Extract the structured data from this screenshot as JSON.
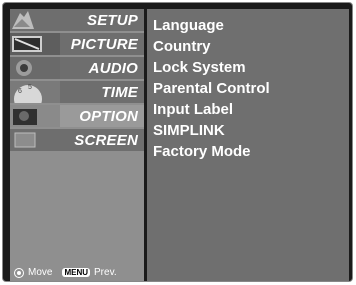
{
  "menu": {
    "items": [
      {
        "label": "SETUP"
      },
      {
        "label": "PICTURE"
      },
      {
        "label": "AUDIO"
      },
      {
        "label": "TIME"
      },
      {
        "label": "OPTION"
      },
      {
        "label": "SCREEN"
      }
    ],
    "selected": "OPTION"
  },
  "footer": {
    "move_label": "Move",
    "menu_badge": "MENU",
    "prev_label": "Prev."
  },
  "options": [
    "Language",
    "Country",
    "Lock System",
    "Parental Control",
    "Input Label",
    "SIMPLINK",
    "Factory Mode"
  ],
  "colors": {
    "panel_bg": "#8f8f8f",
    "item_bg": "#6e6e6e",
    "selected_bg": "#9a9a9a",
    "right_bg": "#6f6f6f",
    "text": "#ffffff"
  }
}
